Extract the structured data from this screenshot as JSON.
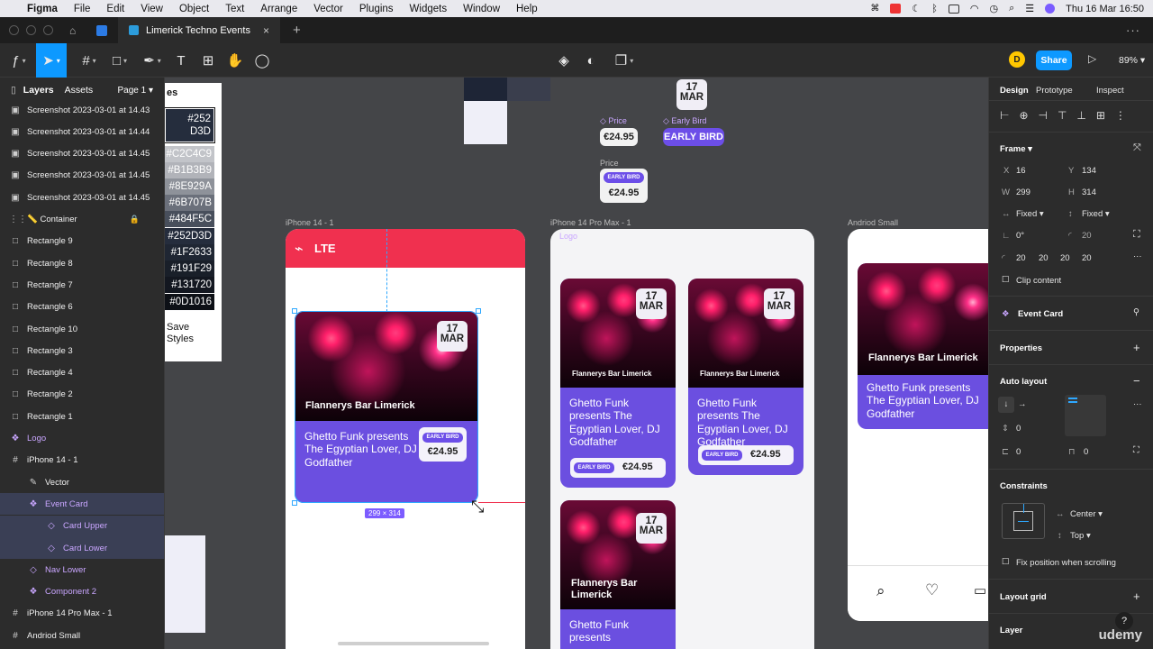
{
  "menubar": {
    "apple": "",
    "app": "Figma",
    "items": [
      "File",
      "Edit",
      "View",
      "Object",
      "Text",
      "Arrange",
      "Vector",
      "Plugins",
      "Widgets",
      "Window",
      "Help"
    ],
    "datetime": "Thu 16 Mar  16:50"
  },
  "tabs": {
    "active_title": "Limerick Techno Events",
    "close": "×",
    "plus": "+",
    "more": "···"
  },
  "toolbar": {
    "avatar_initial": "D",
    "share_label": "Share",
    "zoom": "89%"
  },
  "left_panel": {
    "tab_layers": "Layers",
    "tab_assets": "Assets",
    "page": "Page 1",
    "layers": [
      {
        "name": "Screenshot 2023-03-01 at 14.43",
        "icon": "image-icon",
        "glyph": "▣"
      },
      {
        "name": "Screenshot 2023-03-01 at 14.44",
        "icon": "image-icon",
        "glyph": "▣"
      },
      {
        "name": "Screenshot 2023-03-01 at 14.45",
        "icon": "image-icon",
        "glyph": "▣"
      },
      {
        "name": "Screenshot 2023-03-01 at 14.45",
        "icon": "image-icon",
        "glyph": "▣"
      },
      {
        "name": "Screenshot 2023-03-01 at 14.45",
        "icon": "image-icon",
        "glyph": "▣"
      },
      {
        "name": "📏 Container",
        "icon": "dashed-frame-icon",
        "glyph": "⋮⋮"
      },
      {
        "name": "Rectangle 9",
        "icon": "rectangle-icon",
        "glyph": "□"
      },
      {
        "name": "Rectangle 8",
        "icon": "rectangle-icon",
        "glyph": "□"
      },
      {
        "name": "Rectangle 7",
        "icon": "rectangle-icon",
        "glyph": "□"
      },
      {
        "name": "Rectangle 6",
        "icon": "rectangle-icon",
        "glyph": "□"
      },
      {
        "name": "Rectangle 10",
        "icon": "rectangle-icon",
        "glyph": "□"
      },
      {
        "name": "Rectangle 3",
        "icon": "rectangle-icon",
        "glyph": "□"
      },
      {
        "name": "Rectangle 4",
        "icon": "rectangle-icon",
        "glyph": "□"
      },
      {
        "name": "Rectangle 2",
        "icon": "rectangle-icon",
        "glyph": "□"
      },
      {
        "name": "Rectangle 1",
        "icon": "rectangle-icon",
        "glyph": "□"
      },
      {
        "name": "Logo",
        "icon": "component-icon",
        "glyph": "❖"
      },
      {
        "name": "iPhone 14 - 1",
        "icon": "frame-icon",
        "glyph": "#"
      },
      {
        "name": "Vector",
        "icon": "vector-icon",
        "glyph": "✎"
      },
      {
        "name": "Event Card",
        "icon": "component-icon",
        "glyph": "❖"
      },
      {
        "name": "Card Upper",
        "icon": "instance-icon",
        "glyph": "◇"
      },
      {
        "name": "Card Lower",
        "icon": "instance-icon",
        "glyph": "◇"
      },
      {
        "name": "Nav Lower",
        "icon": "instance-icon",
        "glyph": "◇"
      },
      {
        "name": "Component 2",
        "icon": "component-icon",
        "glyph": "❖"
      },
      {
        "name": "iPhone 14 Pro Max - 1",
        "icon": "frame-icon",
        "glyph": "#"
      },
      {
        "name": "Andriod Small",
        "icon": "frame-icon",
        "glyph": "#"
      }
    ]
  },
  "palette": {
    "swatches": [
      {
        "label": "#252\nD3D",
        "color": "#252D3D"
      },
      {
        "label": "#C2C4C9",
        "color": "#C2C4C9"
      },
      {
        "label": "#B1B3B9",
        "color": "#B1B3B9"
      },
      {
        "label": "#8E929A",
        "color": "#8E929A"
      },
      {
        "label": "#6B707B",
        "color": "#6B707B"
      },
      {
        "label": "#484F5C",
        "color": "#484F5C"
      },
      {
        "label": "#252D3D",
        "color": "#252D3D"
      },
      {
        "label": "#1F2633",
        "color": "#1F2633"
      },
      {
        "label": "#191F29",
        "color": "#191F29"
      },
      {
        "label": "#131720",
        "color": "#131720"
      },
      {
        "label": "#0D1016",
        "color": "#0D1016"
      }
    ],
    "title_fragment": "es",
    "save_label": "Save Styles"
  },
  "components": {
    "date_day": "17",
    "date_month": "MAR",
    "price_label": "Price",
    "price_value": "€24.95",
    "eb_label": "Early Bird",
    "eb_value": "EARLY BIRD",
    "eb_small": "EARLY BIRD"
  },
  "frames": {
    "iphone14": "iPhone 14 - 1",
    "promax": "iPhone 14 Pro Max - 1",
    "android": "Andriod Small",
    "logo_label": "Logo"
  },
  "phone1": {
    "logo_text": "LTE",
    "venue": "Flannerys Bar Limerick",
    "title": "Ghetto Funk presents The Egyptian Lover, DJ Godfather",
    "eb": "EARLY BIRD",
    "price": "€24.95",
    "size_label": "299 × 314"
  },
  "phone2": {
    "venue": "Flannerys Bar Limerick",
    "venue_wrap": "Flannerys Bar Limerick",
    "title": "Ghetto Funk presents The Egyptian Lover, DJ Godfather",
    "title_partial": "Ghetto Funk presents",
    "eb": "EARLY BIRD",
    "price": "€24.95"
  },
  "phone3": {
    "venue": "Flannerys Bar Limerick",
    "title": "Ghetto Funk presents The Egyptian Lover, DJ Godfather"
  },
  "right_panel": {
    "tabs": [
      "Design",
      "Prototype",
      "Inspect"
    ],
    "frame_label": "Frame",
    "x_label": "X",
    "x": "16",
    "y_label": "Y",
    "y": "134",
    "w_label": "W",
    "w": "299",
    "h_label": "H",
    "h": "314",
    "fixed_w": "Fixed",
    "fixed_h": "Fixed",
    "rotation": "0°",
    "radius": "20",
    "pad": [
      "20",
      "20",
      "20",
      "20"
    ],
    "clip": "Clip content",
    "component_name": "Event Card",
    "properties": "Properties",
    "auto_layout": "Auto layout",
    "gap": "0",
    "pad_h": "0",
    "pad_v": "0",
    "constraints": "Constraints",
    "c_h": "Center",
    "c_v": "Top",
    "fix_scroll": "Fix position when scrolling",
    "layout_grid": "Layout grid",
    "layer": "Layer"
  },
  "watermark": "udemy",
  "colors": {
    "accent": "#0d99ff",
    "card": "#6b4fe0",
    "header_red": "#f0304f"
  }
}
